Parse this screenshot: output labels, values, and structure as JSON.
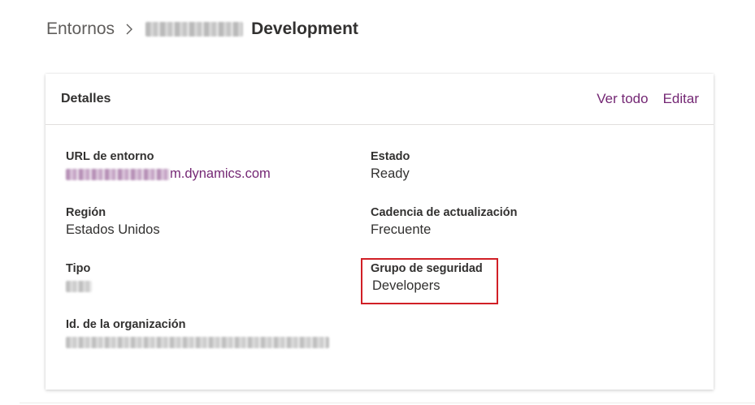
{
  "breadcrumb": {
    "root": "Entornos",
    "current": "Development"
  },
  "details": {
    "title": "Detalles",
    "view_all": "Ver todo",
    "edit": "Editar",
    "url_label": "URL de entorno",
    "url_value_suffix": "m.dynamics.com",
    "state_label": "Estado",
    "state_value": "Ready",
    "region_label": "Región",
    "region_value": "Estados Unidos",
    "cadence_label": "Cadencia de actualización",
    "cadence_value": "Frecuente",
    "type_label": "Tipo",
    "security_label": "Grupo de seguridad",
    "security_value": "Developers",
    "org_id_label": "Id. de la organización"
  },
  "colors": {
    "link": "#742774",
    "highlight": "#d11f26",
    "text": "#323130"
  }
}
